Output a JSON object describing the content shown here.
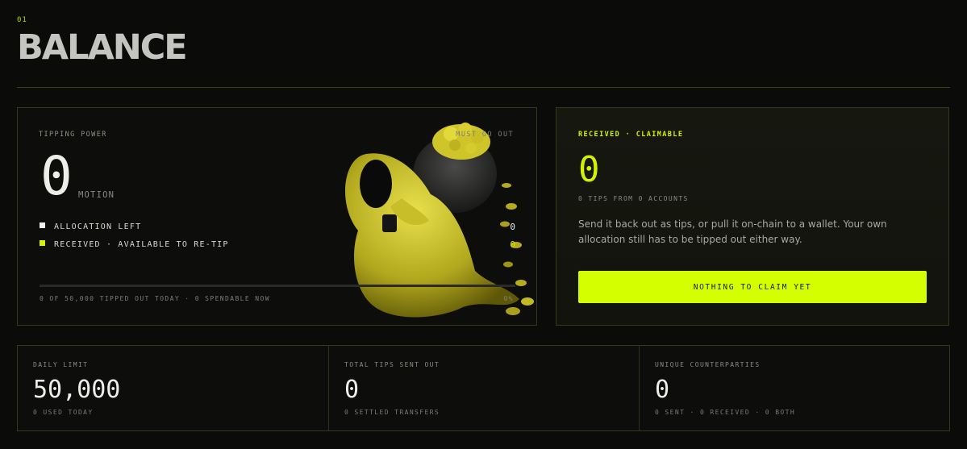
{
  "header": {
    "section_number": "01",
    "title": "BALANCE"
  },
  "tipping_power": {
    "label": "TIPPING POWER",
    "tag": "MUST GO OUT",
    "value": "0",
    "unit": "MOTION",
    "legend": [
      {
        "label": "ALLOCATION LEFT",
        "value": "0",
        "color": "#f0f0ec"
      },
      {
        "label": "RECEIVED · AVAILABLE TO RE-TIP",
        "value": "0",
        "color": "#d4f200"
      }
    ],
    "progress_fraction": 0,
    "footer": "0 OF 50,000 TIPPED OUT TODAY · 0 SPENDABLE NOW",
    "percent": "0%"
  },
  "claimable": {
    "label": "RECEIVED · CLAIMABLE",
    "value": "0",
    "sub": "0 TIPS FROM 0 ACCOUNTS",
    "description": "Send it back out as tips, or pull it on-chain to a wallet. Your own allocation still has to be tipped out either way.",
    "button_label": "NOTHING TO CLAIM YET"
  },
  "stats": [
    {
      "label": "DAILY LIMIT",
      "value": "50,000",
      "sub": "0 USED TODAY"
    },
    {
      "label": "TOTAL TIPS SENT OUT",
      "value": "0",
      "sub": "0 SETTLED TRANSFERS"
    },
    {
      "label": "UNIQUE COUNTERPARTIES",
      "value": "0",
      "sub": "0 SENT · 0 RECEIVED · 0 BOTH"
    }
  ],
  "colors": {
    "accent": "#d4f200",
    "background": "#0b0b0a",
    "border": "#34391c"
  },
  "icons": {
    "mascot": "hooded-figure-with-coin-sack-illustration"
  }
}
